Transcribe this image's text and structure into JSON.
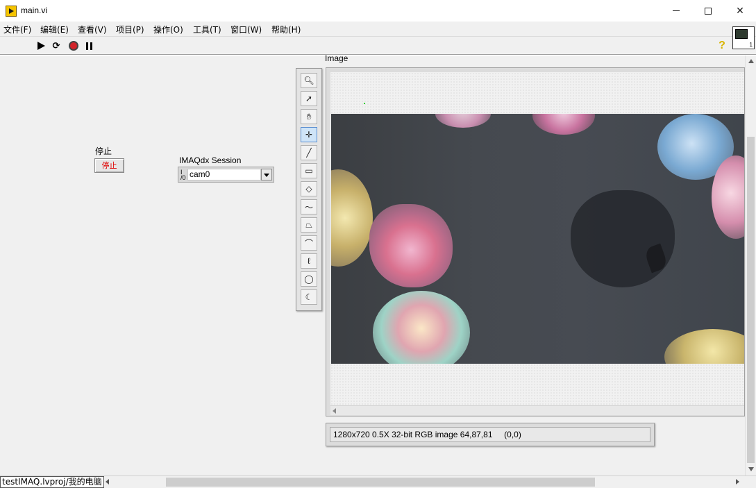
{
  "window": {
    "title": "main.vi",
    "minimize_icon": "minimize-icon",
    "maximize_icon": "maximize-icon",
    "close_icon": "close-icon"
  },
  "menu": [
    {
      "label": "文件(F)"
    },
    {
      "label": "编辑(E)"
    },
    {
      "label": "查看(V)"
    },
    {
      "label": "项目(P)"
    },
    {
      "label": "操作(O)"
    },
    {
      "label": "工具(T)"
    },
    {
      "label": "窗口(W)"
    },
    {
      "label": "帮助(H)"
    }
  ],
  "toolbar": {
    "buttons": [
      "run-icon",
      "run-continuously-icon",
      "abort-icon",
      "pause-icon"
    ],
    "help_glyph": "?",
    "vi_icon_number": "1"
  },
  "panel": {
    "stop": {
      "label": "停止",
      "button_text": "停止"
    },
    "session": {
      "label": "IMAQdx Session",
      "io_glyph": "I/O",
      "value": "cam0"
    },
    "image_label": "Image",
    "tools": [
      "zoom-icon",
      "select-arrow-icon",
      "pan-hand-icon",
      "crosshair-point-icon",
      "line-icon",
      "rectangle-icon",
      "rotated-rectangle-icon",
      "freehand-line-icon",
      "polygon-icon",
      "freehand-icon",
      "freehand-region-icon",
      "oval-icon",
      "annulus-icon"
    ],
    "active_tool": "crosshair-point-icon",
    "info_text": "1280x720 0.5X 32-bit RGB image 64,87,81     (0,0)"
  },
  "statusbar": {
    "project_path": "testIMAQ.lvproj/我的电脑"
  },
  "colors": {
    "stop_text": "#e00000",
    "active_tool": "#cfe4f7",
    "panel_bg": "#f0f0f0"
  }
}
